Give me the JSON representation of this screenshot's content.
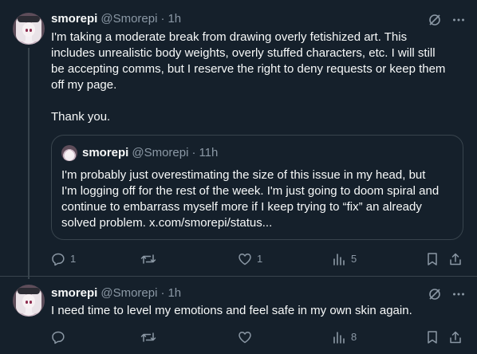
{
  "tweets": [
    {
      "name": "smorepi",
      "handle": "@Smorepi",
      "dot": "·",
      "time": "1h",
      "text_lines": [
        "I'm taking a moderate break from drawing overly fetishized art. This",
        "includes unrealistic body weights, overly stuffed characters, etc. I will still",
        "be accepting comms, but I reserve the right to deny requests or keep them",
        "off my page.",
        "",
        "Thank you."
      ],
      "quote": {
        "name": "smorepi",
        "handle": "@Smorepi",
        "dot": "·",
        "time": "11h",
        "text_lines": [
          "I'm probably just overestimating the size of this issue in my head, but",
          "I'm logging off for the rest of the week. I'm just going to doom spiral and",
          "continue to embarrass myself more if I keep trying to “fix” an already",
          "solved problem. x.com/smorepi/status..."
        ]
      },
      "actions": {
        "replies": "1",
        "retweets": "",
        "likes": "1",
        "views": "5"
      }
    },
    {
      "name": "smorepi",
      "handle": "@Smorepi",
      "dot": "·",
      "time": "1h",
      "text_lines": [
        "I need time to level my emotions and feel safe in my own skin again."
      ],
      "actions": {
        "replies": "",
        "retweets": "",
        "likes": "",
        "views": "8"
      }
    }
  ],
  "icons": {
    "grok": "grok-icon",
    "more": "more-icon",
    "reply": "reply-icon",
    "retweet": "retweet-icon",
    "like": "like-icon",
    "views": "views-icon",
    "bookmark": "bookmark-icon",
    "share": "share-icon"
  },
  "colors": {
    "background": "#15202b",
    "text": "#f7f9f9",
    "muted": "#8b98a5",
    "border": "#38444d"
  }
}
